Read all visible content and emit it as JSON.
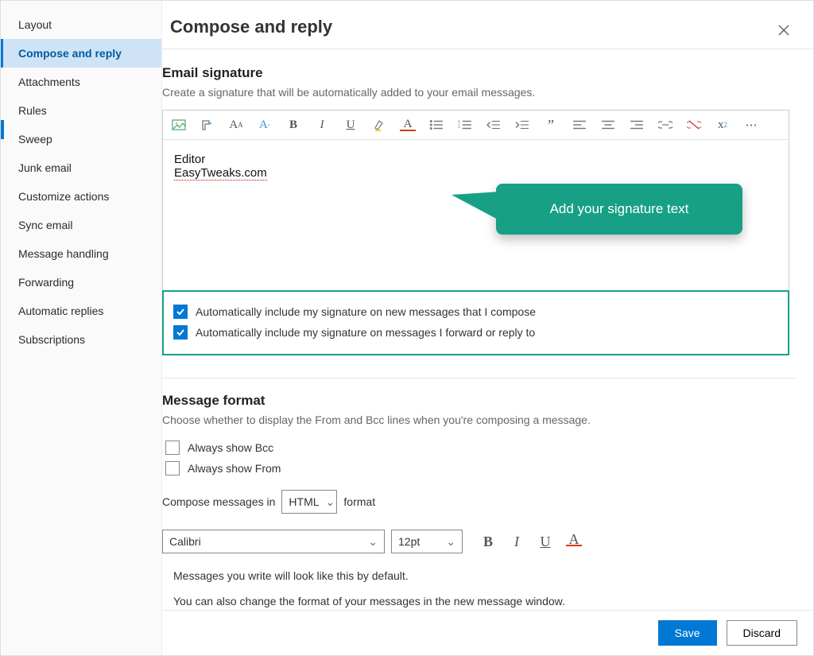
{
  "sidebar": {
    "items": [
      {
        "label": "Layout",
        "active": false
      },
      {
        "label": "Compose and reply",
        "active": true
      },
      {
        "label": "Attachments",
        "active": false
      },
      {
        "label": "Rules",
        "active": false
      },
      {
        "label": "Sweep",
        "active": false
      },
      {
        "label": "Junk email",
        "active": false
      },
      {
        "label": "Customize actions",
        "active": false
      },
      {
        "label": "Sync email",
        "active": false
      },
      {
        "label": "Message handling",
        "active": false
      },
      {
        "label": "Forwarding",
        "active": false
      },
      {
        "label": "Automatic replies",
        "active": false
      },
      {
        "label": "Subscriptions",
        "active": false
      }
    ]
  },
  "header": {
    "title": "Compose and reply"
  },
  "signature": {
    "heading": "Email signature",
    "desc": "Create a signature that will be automatically added to your email messages.",
    "line1": "Editor",
    "line2": "EasyTweaks.com",
    "callout": "Add your signature text",
    "chk_new": "Automatically include my signature on new messages that I compose",
    "chk_reply": "Automatically include my signature on messages I forward or reply to"
  },
  "format": {
    "heading": "Message format",
    "desc": "Choose whether to display the From and Bcc lines when you're composing a message.",
    "show_bcc": "Always show Bcc",
    "show_from": "Always show From",
    "compose_prefix": "Compose messages in",
    "compose_value": "HTML",
    "compose_suffix": "format",
    "font": "Calibri",
    "size": "12pt",
    "preview1": "Messages you write will look like this by default.",
    "preview2": "You can also change the format of your messages in the new message window."
  },
  "footer": {
    "save": "Save",
    "discard": "Discard"
  },
  "toolbar_icons": [
    "insert-image-icon",
    "format-painter-icon",
    "font-size-decrease-icon",
    "font-size-increase-icon",
    "bold-icon",
    "italic-icon",
    "underline-icon",
    "highlight-icon",
    "font-color-icon",
    "bulleted-list-icon",
    "numbered-list-icon",
    "decrease-indent-icon",
    "increase-indent-icon",
    "quote-icon",
    "align-left-icon",
    "align-center-icon",
    "align-right-icon",
    "link-icon",
    "unlink-icon",
    "superscript-icon",
    "more-icon"
  ]
}
